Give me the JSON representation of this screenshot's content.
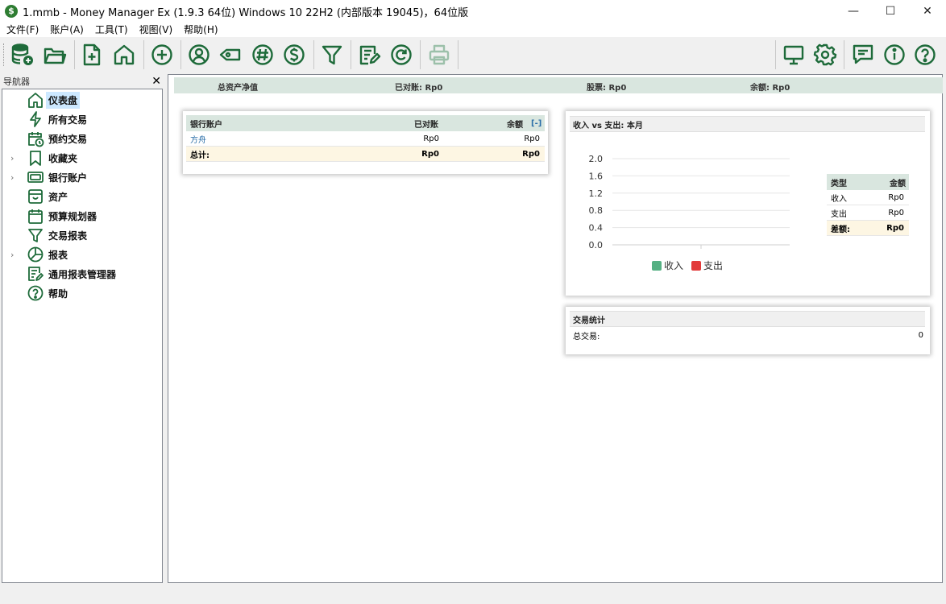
{
  "window": {
    "title": "1.mmb - Money Manager Ex (1.9.3 64位) Windows 10 22H2 (内部版本 19045)，64位版",
    "app_icon_glyph": "$",
    "minimize_glyph": "—",
    "maximize_glyph": "☐",
    "close_glyph": "✕"
  },
  "menu": [
    "文件(F)",
    "账户(A)",
    "工具(T)",
    "视图(V)",
    "帮助(H)"
  ],
  "toolbar": {
    "icon_color": "#1e6b3a",
    "disabled_color": "#9cc0aa",
    "buttons": [
      "new-database-icon",
      "open-folder-icon",
      "new-file-icon",
      "home-icon",
      "add-circle-icon",
      "user-icon",
      "tag-icon",
      "hash-icon",
      "currency-icon",
      "filter-icon",
      "edit-report-icon",
      "refresh-icon",
      "print-icon",
      "monitor-icon",
      "settings-icon",
      "chat-icon",
      "info-icon",
      "help-icon"
    ]
  },
  "navigator": {
    "title": "导航器",
    "close_glyph": "✕",
    "items": [
      {
        "label": "仪表盘",
        "icon": "home-icon",
        "expandable": false,
        "selected": true
      },
      {
        "label": "所有交易",
        "icon": "lightning-icon",
        "expandable": false
      },
      {
        "label": "预约交易",
        "icon": "calendar-clock-icon",
        "expandable": false
      },
      {
        "label": "收藏夹",
        "icon": "bookmark-icon",
        "expandable": true
      },
      {
        "label": "银行账户",
        "icon": "bank-note-icon",
        "expandable": true
      },
      {
        "label": "资产",
        "icon": "box-icon",
        "expandable": false
      },
      {
        "label": "预算规划器",
        "icon": "calendar-icon",
        "expandable": false
      },
      {
        "label": "交易报表",
        "icon": "filter-icon",
        "expandable": false
      },
      {
        "label": "报表",
        "icon": "pie-chart-icon",
        "expandable": true
      },
      {
        "label": "通用报表管理器",
        "icon": "edit-report-icon",
        "expandable": false
      },
      {
        "label": "帮助",
        "icon": "help-icon",
        "expandable": false
      }
    ],
    "expander_glyph": "›"
  },
  "summary": {
    "net_worth": "总资产净值",
    "reconciled": "已对账: Rp0",
    "stocks": "股票: Rp0",
    "balance": "余额: Rp0"
  },
  "bank_accounts": {
    "headers": {
      "account": "银行账户",
      "reconciled": "已对账",
      "balance": "余额",
      "toggle": "[-]"
    },
    "rows": [
      {
        "name": "方舟",
        "reconciled": "Rp0",
        "balance": "Rp0"
      }
    ],
    "total": {
      "label": "总计:",
      "reconciled": "Rp0",
      "balance": "Rp0"
    }
  },
  "income_expense": {
    "title": "收入 vs 支出: 本月",
    "table": {
      "headers": {
        "type": "类型",
        "amount": "金额"
      },
      "rows": [
        {
          "type": "收入",
          "amount": "Rp0"
        },
        {
          "type": "支出",
          "amount": "Rp0"
        }
      ],
      "total": {
        "label": "差额:",
        "amount": "Rp0"
      }
    }
  },
  "chart_data": {
    "type": "bar",
    "title": "",
    "categories": [
      ""
    ],
    "series": [
      {
        "name": "收入",
        "values": [
          0
        ],
        "color": "#55b083"
      },
      {
        "name": "支出",
        "values": [
          0
        ],
        "color": "#e23a3a"
      }
    ],
    "ylim": [
      0,
      2.0
    ],
    "yticks": [
      "2.0",
      "1.6",
      "1.2",
      "0.8",
      "0.4",
      "0.0"
    ],
    "grid": true,
    "legend": "bottom"
  },
  "stats": {
    "title": "交易统计",
    "rows": [
      {
        "label": "总交易:",
        "value": "0"
      }
    ]
  }
}
